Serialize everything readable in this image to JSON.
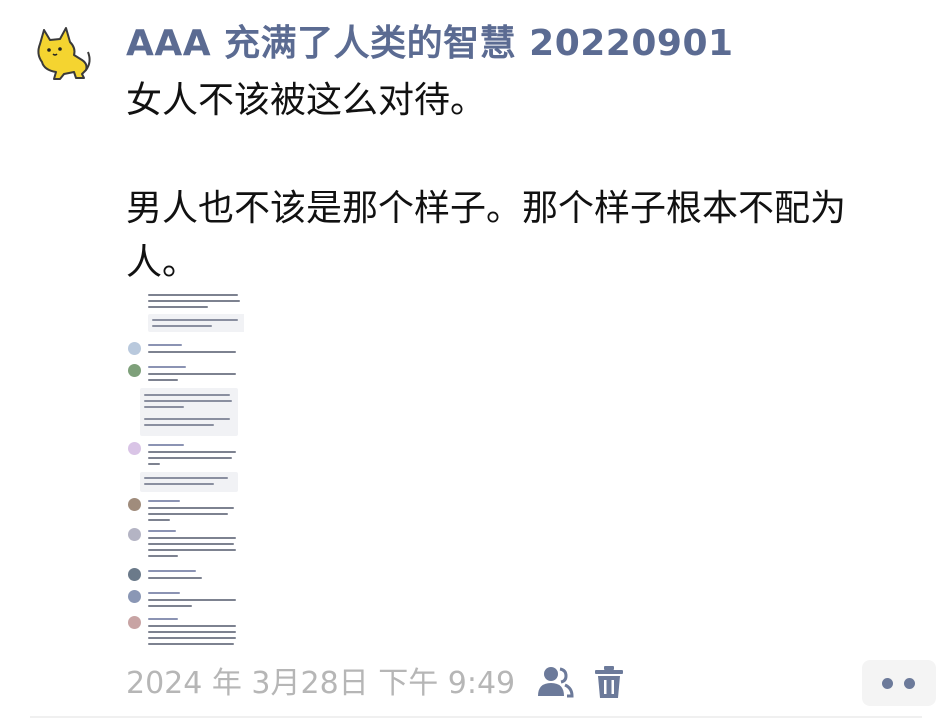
{
  "post": {
    "username": "AAA 充满了人类的智慧 20220901",
    "paragraph_1": "女人不该被这么对待。",
    "paragraph_2": "男人也不该是那个样子。那个样子根本不配为人。",
    "timestamp": "2024 年 3月28日 下午 9:49"
  },
  "icons": {
    "avatar": "cat-avatar-icon",
    "visibility": "people-icon",
    "delete": "trash-icon",
    "more": "more-icon"
  },
  "colors": {
    "username": "#5b6b92",
    "timestamp": "#b6b6b6",
    "icon": "#6c7a9a",
    "avatar": "#f4d430"
  }
}
